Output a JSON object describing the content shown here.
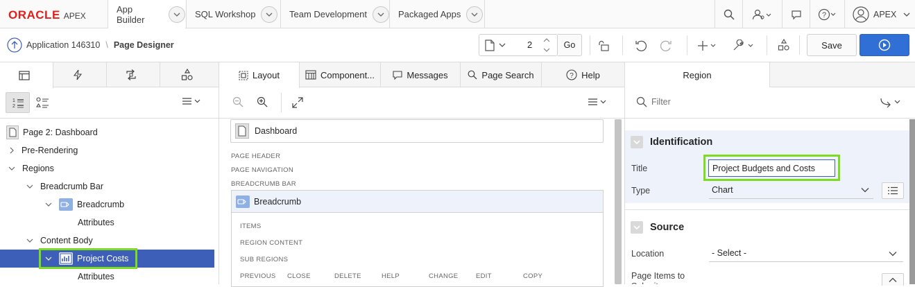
{
  "topnav": {
    "logo_oracle": "ORACLE",
    "logo_apex": "APEX",
    "tabs": [
      {
        "label": "App Builder"
      },
      {
        "label": "SQL Workshop"
      },
      {
        "label": "Team Development"
      },
      {
        "label": "Packaged Apps"
      }
    ],
    "user_label": "APEX"
  },
  "toolbar": {
    "breadcrumb_app": "Application 146310",
    "breadcrumb_sep": "\\",
    "breadcrumb_current": "Page Designer",
    "page_number": "2",
    "go_label": "Go",
    "save_label": "Save"
  },
  "left_panel": {
    "tree": [
      {
        "label": "Page 2: Dashboard"
      },
      {
        "label": "Pre-Rendering"
      },
      {
        "label": "Regions"
      },
      {
        "label": "Breadcrumb Bar"
      },
      {
        "label": "Breadcrumb"
      },
      {
        "label": "Attributes"
      },
      {
        "label": "Content Body"
      },
      {
        "label": "Project Costs"
      },
      {
        "label": "Attributes"
      }
    ]
  },
  "center_panel": {
    "tabs": [
      {
        "label": "Layout"
      },
      {
        "label": "Component..."
      },
      {
        "label": "Messages"
      },
      {
        "label": "Page Search"
      },
      {
        "label": "Help"
      }
    ],
    "page_title": "Dashboard",
    "positions": {
      "page_header": "PAGE HEADER",
      "page_navigation": "PAGE NAVIGATION",
      "breadcrumb_bar": "BREADCRUMB BAR"
    },
    "breadcrumb_region": "Breadcrumb",
    "region_slots": {
      "items": "ITEMS",
      "region_content": "REGION CONTENT",
      "sub_regions": "SUB REGIONS"
    },
    "button_positions": [
      "PREVIOUS",
      "CLOSE",
      "DELETE",
      "HELP",
      "CHANGE",
      "EDIT",
      "COPY"
    ]
  },
  "right_panel": {
    "tab": "Region",
    "filter_placeholder": "Filter",
    "sections": {
      "identification": "Identification",
      "source": "Source"
    },
    "properties": {
      "title_label": "Title",
      "title_value": "Project Budgets and Costs",
      "type_label": "Type",
      "type_value": "Chart",
      "location_label": "Location",
      "location_value": "- Select -",
      "page_items_label": "Page Items to Submit"
    }
  },
  "colors": {
    "oracle_red": "#e0201c",
    "accent_blue": "#3d5fb8",
    "highlight_green": "#7ddc1f",
    "run_button_blue": "#2f6fd6"
  }
}
